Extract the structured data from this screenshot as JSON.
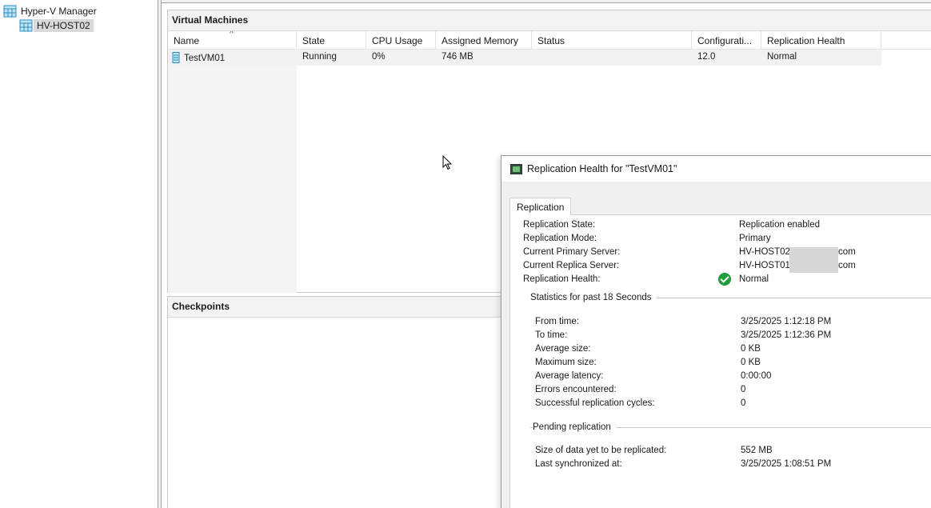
{
  "tree": {
    "root_label": "Hyper-V Manager",
    "host_label": "HV-HOST02"
  },
  "vm_panel": {
    "title": "Virtual Machines",
    "columns": [
      "Name",
      "State",
      "CPU Usage",
      "Assigned Memory",
      "Status",
      "Configurati...",
      "Replication Health"
    ],
    "rows": [
      {
        "name": "TestVM01",
        "state": "Running",
        "cpu": "0%",
        "memory": "746 MB",
        "status": "",
        "config": "12.0",
        "replication": "Normal"
      }
    ]
  },
  "checkpoints_panel": {
    "title": "Checkpoints"
  },
  "dialog": {
    "title": "Replication Health for \"TestVM01\"",
    "tab_label": "Replication",
    "fields": [
      {
        "label": "Replication State:",
        "value": "Replication enabled"
      },
      {
        "label": "Replication Mode:",
        "value": "Primary"
      },
      {
        "label": "Current Primary Server:",
        "value_prefix": "HV-HOST02.",
        "value_suffix": "com"
      },
      {
        "label": "Current Replica Server:",
        "value_prefix": "HV-HOST01.",
        "value_suffix": "com"
      },
      {
        "label": "Replication Health:",
        "value": "Normal"
      }
    ],
    "stats_title": "Statistics for past 18 Seconds",
    "stats": [
      {
        "label": "From time:",
        "value": "3/25/2025 1:12:18 PM"
      },
      {
        "label": "To time:",
        "value": "3/25/2025 1:12:36 PM"
      },
      {
        "label": "Average size:",
        "value": "0 KB"
      },
      {
        "label": "Maximum size:",
        "value": "0 KB"
      },
      {
        "label": "Average latency:",
        "value": "0:00:00"
      },
      {
        "label": "Errors encountered:",
        "value": "0"
      },
      {
        "label": "Successful replication cycles:",
        "value": "0"
      }
    ],
    "pending_title": "Pending replication",
    "pending": [
      {
        "label": "Size of data yet to be replicated:",
        "value": "552 MB"
      },
      {
        "label": "Last synchronized at:",
        "value": "3/25/2025 1:08:51 PM"
      }
    ]
  },
  "colors": {
    "tree_icon": "#3a9fd0",
    "health_ok": "#1f9d3a",
    "selection": "#d9d9d9"
  }
}
